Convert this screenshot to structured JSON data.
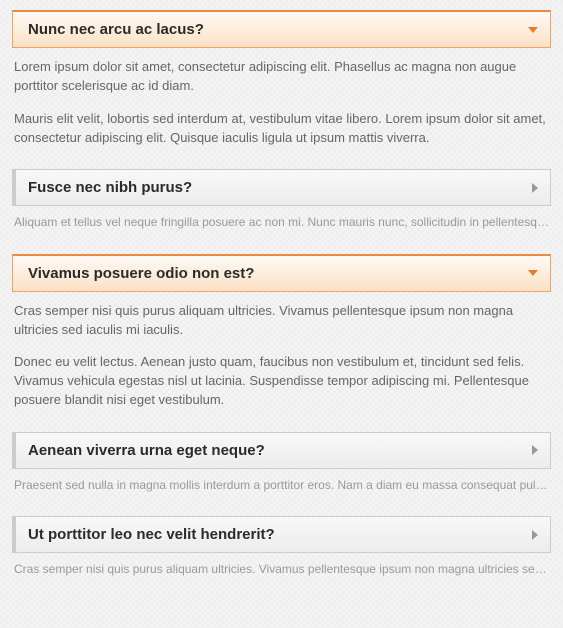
{
  "items": [
    {
      "title": "Nunc nec arcu ac lacus?",
      "expanded": true,
      "paragraphs": [
        "Lorem ipsum dolor sit amet, consectetur adipiscing elit. Phasellus ac magna non augue porttitor scelerisque ac id diam.",
        "Mauris elit velit, lobortis sed interdum at, vestibulum vitae libero. Lorem ipsum dolor sit amet, consectetur adipiscing elit. Quisque iaculis ligula ut ipsum mattis viverra."
      ]
    },
    {
      "title": "Fusce nec nibh purus?",
      "expanded": false,
      "preview": "Aliquam et tellus vel neque fringilla posuere ac non mi. Nunc mauris nunc, sollicitudin in pellentesque eget."
    },
    {
      "title": "Vivamus posuere odio non est?",
      "expanded": true,
      "paragraphs": [
        "Cras semper nisi quis purus aliquam ultricies. Vivamus pellentesque ipsum non magna ultricies sed iaculis mi iaculis.",
        "Donec eu velit lectus. Aenean justo quam, faucibus non vestibulum et, tincidunt sed felis. Vivamus vehicula egestas nisl ut lacinia. Suspendisse tempor adipiscing mi. Pellentesque posuere blandit nisi eget vestibulum."
      ]
    },
    {
      "title": "Aenean viverra urna eget neque?",
      "expanded": false,
      "preview": "Praesent sed nulla in magna mollis interdum a porttitor eros. Nam a diam eu massa consequat pulvinar."
    },
    {
      "title": "Ut porttitor leo nec velit hendrerit?",
      "expanded": false,
      "preview": "Cras semper nisi quis purus aliquam ultricies. Vivamus pellentesque ipsum non magna ultricies sed iaculis."
    }
  ]
}
